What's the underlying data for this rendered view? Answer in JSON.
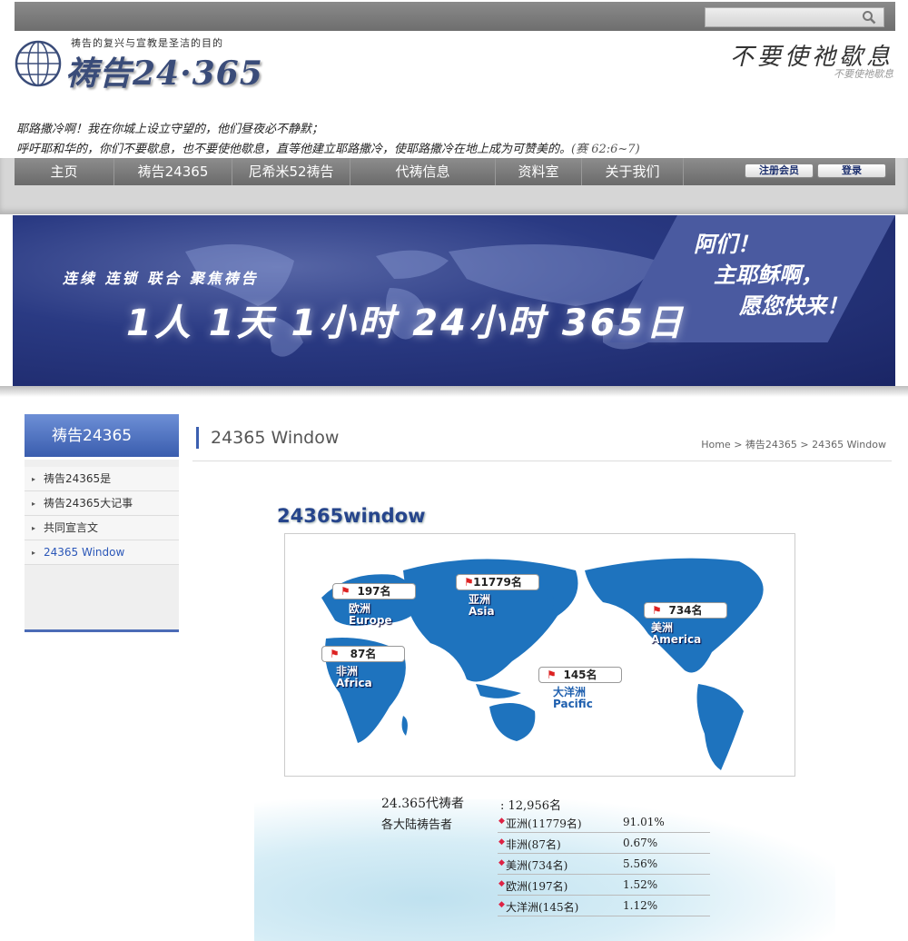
{
  "search": {
    "placeholder": ""
  },
  "logo": {
    "tagline": "祷告的复兴与宣教是圣洁的目的",
    "title": "祷告24·365"
  },
  "slogan": {
    "script": "不要使祂歇息",
    "caption": "不要使祂歇息"
  },
  "verse": {
    "line1": "耶路撒冷啊！我在你城上设立守望的，他们昼夜必不静默；",
    "line2": "呼吁耶和华的，你们不要歇息，也不要使他歇息，直等他建立耶路撒冷，使耶路撒冷在地上成为可赞美的。",
    "ref": "(赛 62:6~7)"
  },
  "nav": {
    "items": [
      "主页",
      "祷告24365",
      "尼希米52祷告",
      "代祷信息",
      "资料室",
      "关于我们"
    ],
    "register": "注册会员",
    "login": "登录"
  },
  "banner": {
    "small": "连续 连锁 联合 聚焦祷告",
    "big": "1人 1天 1小时 24小时 365日",
    "right1": "阿们！",
    "right2": "主耶稣啊，",
    "right3": "愿您快来！"
  },
  "sidebar": {
    "title": "祷告24365",
    "items": [
      "祷告24365是",
      "祷告24365大记事",
      "共同宣言文",
      "24365 Window"
    ]
  },
  "content": {
    "title": "24365 Window",
    "breadcrumb": [
      "Home",
      "祷告24365",
      "24365 Window"
    ],
    "window_title": "24365window"
  },
  "map": {
    "regions": [
      {
        "count": "197名",
        "zh": "欧洲",
        "en": "Europe"
      },
      {
        "count": "11779名",
        "zh": "亚洲",
        "en": "Asia"
      },
      {
        "count": "734名",
        "zh": "美洲",
        "en": "America"
      },
      {
        "count": "87名",
        "zh": "非洲",
        "en": "Africa"
      },
      {
        "count": "145名",
        "zh": "大洋洲",
        "en": "Pacific"
      }
    ]
  },
  "stats": {
    "total_label": "24.365代祷者",
    "total_value": ": 12,956名",
    "continent_label": "各大陆祷告者",
    "rows": [
      {
        "name": "亚洲(11779名)",
        "pct": "91.01%"
      },
      {
        "name": "非洲(87名)",
        "pct": "0.67%"
      },
      {
        "name": "美洲(734名)",
        "pct": "5.56%"
      },
      {
        "name": "欧洲(197名)",
        "pct": "1.52%"
      },
      {
        "name": "大洋洲(145名)",
        "pct": "1.12%"
      }
    ]
  },
  "colors": {
    "brand_blue": "#2b57b8",
    "map_blue": "#1e73be",
    "nav_gray": "#7a7a7a"
  }
}
